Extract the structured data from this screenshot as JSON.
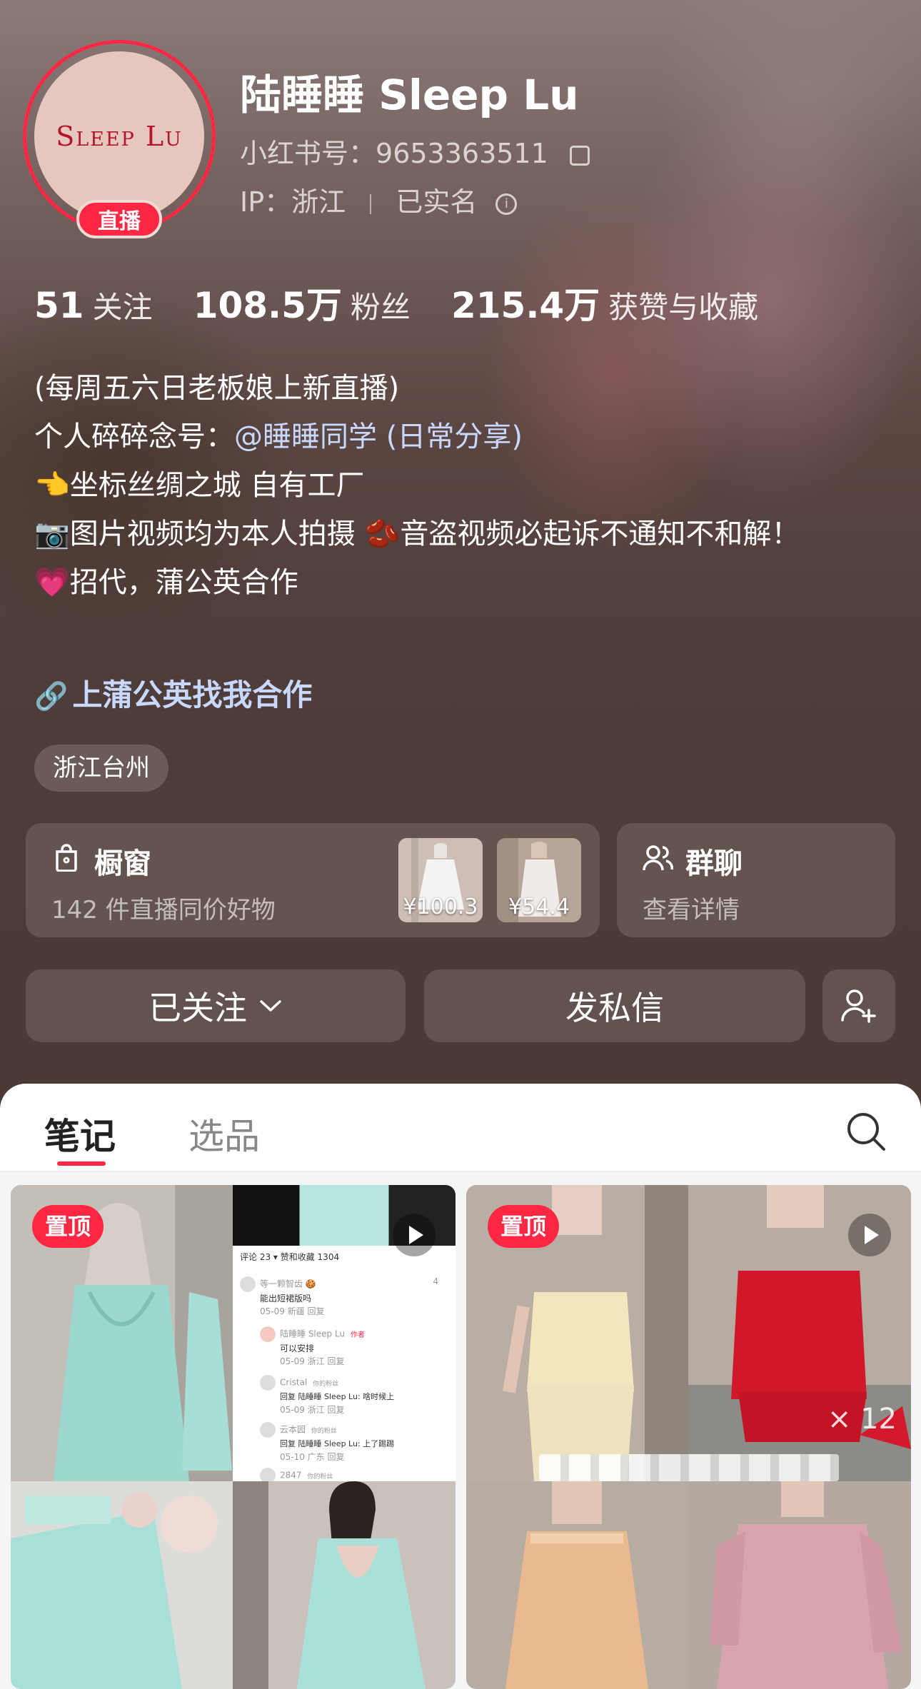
{
  "profile": {
    "avatar_text": "Sleep Lu",
    "live_badge": "直播",
    "name": "陆睡睡 Sleep Lu",
    "red_id_label": "小红书号：",
    "red_id": "9653363511",
    "ip_label": "IP：浙江",
    "verified": "已实名"
  },
  "stats": [
    {
      "value": "51",
      "label": "关注"
    },
    {
      "value": "108.5万",
      "label": "粉丝"
    },
    {
      "value": "215.4万",
      "label": "获赞与收藏"
    }
  ],
  "bio": {
    "line1": "(每周五六日老板娘上新直播)",
    "line2_prefix": "个人碎碎念号：",
    "line2_mention": "@睡睡同学 (日常分享)",
    "line3": "👈坐标丝绸之城 自有工厂",
    "line4": "📷图片视频均为本人拍摄 🫘音盗视频必起诉不通知不和解！",
    "line5": "💗招代，蒲公英合作"
  },
  "link": {
    "label": "上蒲公英找我合作"
  },
  "location_tag": "浙江台州",
  "shop_card": {
    "title": "橱窗",
    "subtitle": "142 件直播同价好物",
    "thumbs": [
      {
        "price": "¥100.3"
      },
      {
        "price": "¥54.4"
      }
    ]
  },
  "group_card": {
    "title": "群聊",
    "subtitle": "查看详情"
  },
  "actions": {
    "follow": "已关注",
    "message": "发私信"
  },
  "tabs": [
    {
      "label": "笔记",
      "active": true
    },
    {
      "label": "选品",
      "active": false
    }
  ],
  "notes": [
    {
      "pinned_label": "置顶",
      "comment_shot": {
        "header": "评论 23 ▾    赞和收藏 1304",
        "rows": [
          {
            "name": "等一颗智齿 🍪",
            "text": "能出短裙版吗",
            "meta": "05-09 新疆  回复",
            "likes": "4"
          },
          {
            "name": "陆睡睡 Sleep Lu",
            "tag": "作者",
            "text": "可以安排",
            "meta": "05-09 浙江  回复",
            "likes": ""
          },
          {
            "name": "Cristal",
            "tag": "你的粉丝",
            "text": "回复 陆睡睡 Sleep Lu: 啥时候上",
            "meta": "05-09 浙江  回复",
            "likes": ""
          },
          {
            "name": "云本园",
            "tag": "你的粉丝",
            "text": "回复 陆睡睡 Sleep Lu: 上了踢踢",
            "meta": "05-10 广东  回复",
            "likes": ""
          },
          {
            "name": "2847",
            "tag": "你的粉丝",
            "text": "",
            "meta": "",
            "likes": ""
          }
        ]
      }
    },
    {
      "pinned_label": "置顶",
      "overlay_text": "× 12"
    }
  ],
  "colors": {
    "accent": "#ff2742",
    "link": "#c9d8ff",
    "panel": "#ffffff"
  },
  "icons": [
    "copy-icon",
    "info-icon",
    "link-icon",
    "bag-icon",
    "people-icon",
    "chevron-down-icon",
    "add-user-icon",
    "search-icon",
    "play-icon"
  ]
}
